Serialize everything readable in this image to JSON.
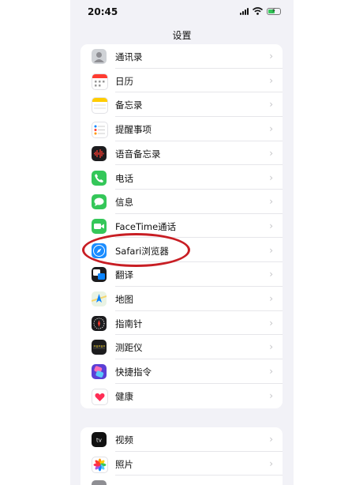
{
  "status_bar": {
    "time": "20:45"
  },
  "nav": {
    "title": "设置"
  },
  "group1": [
    {
      "label": "通讯录",
      "icon": "contacts-icon",
      "color": "#cfd2d6"
    },
    {
      "label": "日历",
      "icon": "calendar-icon",
      "color": "#ffffff"
    },
    {
      "label": "备忘录",
      "icon": "notes-icon",
      "color": "#ffffff"
    },
    {
      "label": "提醒事项",
      "icon": "reminders-icon",
      "color": "#ffffff"
    },
    {
      "label": "语音备忘录",
      "icon": "voice-memos-icon",
      "color": "#1c1c1e"
    },
    {
      "label": "电话",
      "icon": "phone-icon",
      "color": "#34c759"
    },
    {
      "label": "信息",
      "icon": "messages-icon",
      "color": "#34c759"
    },
    {
      "label": "FaceTime通话",
      "icon": "facetime-icon",
      "color": "#34c759"
    },
    {
      "label": "Safari浏览器",
      "icon": "safari-icon",
      "color": "#1a8cff"
    },
    {
      "label": "翻译",
      "icon": "translate-icon",
      "color": "#1c1c1e"
    },
    {
      "label": "地图",
      "icon": "maps-icon",
      "color": "#e9f3e4"
    },
    {
      "label": "指南针",
      "icon": "compass-icon",
      "color": "#1c1c1e"
    },
    {
      "label": "测距仪",
      "icon": "measure-icon",
      "color": "#1c1c1e"
    },
    {
      "label": "快捷指令",
      "icon": "shortcuts-icon",
      "color": "#5b3fd6"
    },
    {
      "label": "健康",
      "icon": "health-icon",
      "color": "#ffffff"
    }
  ],
  "group2": [
    {
      "label": "视频",
      "icon": "apple-tv-icon",
      "color": "#111111"
    },
    {
      "label": "照片",
      "icon": "photos-icon",
      "color": "#ffffff"
    },
    {
      "label": "",
      "icon": "camera-icon",
      "color": "#8e8e93"
    }
  ]
}
